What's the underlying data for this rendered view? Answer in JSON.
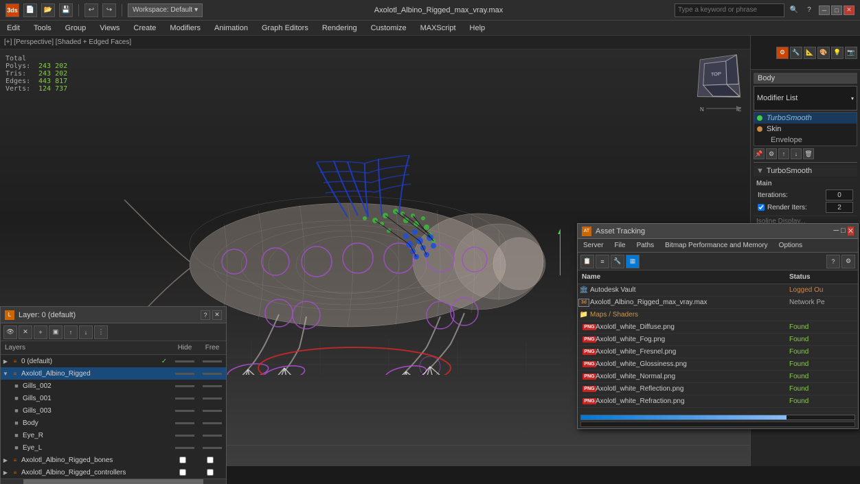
{
  "titlebar": {
    "title": "Axolotl_Albino_Rigged_max_vray.max",
    "search_placeholder": "Type a keyword or phrase",
    "workspace": "Workspace: Default"
  },
  "menu": {
    "items": [
      "Edit",
      "Tools",
      "Group",
      "Views",
      "Create",
      "Modifiers",
      "Animation",
      "Graph Editors",
      "Rendering",
      "Customize",
      "MAXScript",
      "Help"
    ]
  },
  "viewport": {
    "label": "[+] [Perspective] [Shaded + Edged Faces]",
    "stats": {
      "polys_label": "Polys:",
      "polys_value": "243 202",
      "tris_label": "Tris:",
      "tris_value": "243 202",
      "edges_label": "Edges:",
      "edges_value": "443 817",
      "verts_label": "Verts:",
      "verts_value": "124 737",
      "total_label": "Total"
    }
  },
  "right_panel": {
    "object_name": "Body",
    "modifier_list_label": "Modifier List",
    "modifiers": [
      {
        "name": "TurboSmooth",
        "type": "turbosmooth",
        "active": true
      },
      {
        "name": "Skin",
        "type": "skin",
        "active": false
      },
      {
        "name": "Envelope",
        "type": "envelope",
        "active": false,
        "indent": true
      }
    ],
    "turbosmooth": {
      "section_label": "TurboSmooth",
      "main_label": "Main",
      "iterations_label": "Iterations:",
      "iterations_value": "0",
      "render_iters_label": "Render Iters:",
      "render_iters_value": "2"
    }
  },
  "layers_panel": {
    "title": "Layer: 0 (default)",
    "header": "Layers",
    "col_hide": "Hide",
    "col_free": "Free",
    "layers": [
      {
        "name": "0 (default)",
        "level": 0,
        "checked": true,
        "type": "layer"
      },
      {
        "name": "Axolotl_Albino_Rigged",
        "level": 0,
        "selected": true,
        "type": "layer"
      },
      {
        "name": "Gills_002",
        "level": 1,
        "type": "object"
      },
      {
        "name": "Gills_001",
        "level": 1,
        "type": "object"
      },
      {
        "name": "Gills_003",
        "level": 1,
        "type": "object"
      },
      {
        "name": "Body",
        "level": 1,
        "type": "object"
      },
      {
        "name": "Eye_R",
        "level": 1,
        "type": "object"
      },
      {
        "name": "Eye_L",
        "level": 1,
        "type": "object"
      },
      {
        "name": "Axolotl_Albino_Rigged_bones",
        "level": 0,
        "type": "layer"
      },
      {
        "name": "Axolotl_Albino_Rigged_controllers",
        "level": 0,
        "type": "layer"
      }
    ]
  },
  "asset_panel": {
    "title": "Asset Tracking",
    "menus": [
      "Server",
      "File",
      "Paths",
      "Bitmap Performance and Memory",
      "Options"
    ],
    "col_name": "Name",
    "col_status": "Status",
    "items": [
      {
        "name": "Autodesk Vault",
        "status": "Logged Ou",
        "type": "vault",
        "level": 0
      },
      {
        "name": "Axolotl_Albino_Rigged_max_vray.max",
        "status": "Network Pe",
        "type": "max",
        "level": 0
      },
      {
        "name": "Maps / Shaders",
        "status": "",
        "type": "folder",
        "level": 0
      },
      {
        "name": "Axolotl_white_Diffuse.png",
        "status": "Found",
        "type": "png",
        "level": 1
      },
      {
        "name": "Axolotl_white_Fog.png",
        "status": "Found",
        "type": "png",
        "level": 1
      },
      {
        "name": "Axolotl_white_Fresnel.png",
        "status": "Found",
        "type": "png",
        "level": 1
      },
      {
        "name": "Axolotl_white_Glossiness.png",
        "status": "Found",
        "type": "png",
        "level": 1
      },
      {
        "name": "Axolotl_white_Normal.png",
        "status": "Found",
        "type": "png",
        "level": 1
      },
      {
        "name": "Axolotl_white_Reflection.png",
        "status": "Found",
        "type": "png",
        "level": 1
      },
      {
        "name": "Axolotl_white_Refraction.png",
        "status": "Found",
        "type": "png",
        "level": 1
      }
    ]
  },
  "icons": {
    "close": "✕",
    "minimize": "─",
    "maximize": "□",
    "expand": "▶",
    "collapse": "▼",
    "check": "✓",
    "gear": "⚙",
    "folder": "📁",
    "add": "+",
    "delete": "✕",
    "question": "?",
    "arrow_down": "▾",
    "arrow_right": "▸"
  }
}
